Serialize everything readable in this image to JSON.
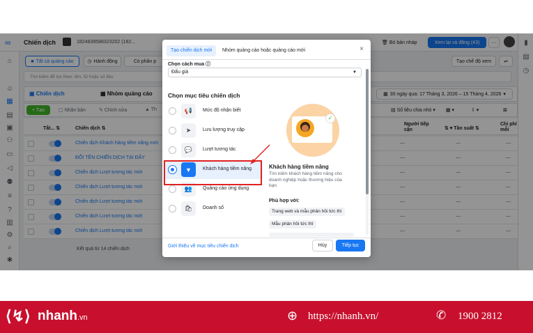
{
  "app": {
    "title": "Chiến dịch",
    "account_id": "1824839588323202 (182...",
    "draft_label": "Bỏ bản nháp",
    "review_button": "Xem lại và đăng (43)",
    "more": "···",
    "tabs": [
      "Tất cả quảng cáo",
      "Hành động",
      "Có phần p"
    ],
    "create_view": "Tạo chế độ xem",
    "search_placeholder": "Tìm kiếm để lọc theo: tên, ID hoặc số liệu",
    "level_tabs": [
      "Chiến dịch",
      "Nhóm quảng cáo"
    ],
    "date_range": "30 ngày qua: 17 Tháng 3, 2026 – 15 Tháng 4, 2026",
    "toolbar": {
      "create": "+ Tạo",
      "duplicate": "Nhân bản",
      "edit": "Chỉnh sửa",
      "third": "Th"
    },
    "right_toolbar": {
      "breakdown": "Số liệu chia nhỏ"
    },
    "columns": [
      "Tắt...",
      "Chiến dịch",
      "Người tiếp cận",
      "Tần suất",
      "Chi phí mỗi"
    ],
    "rows": [
      "Chiến dịch Khách hàng tiềm năng mới",
      "ĐỔI TÊN CHIẾN DỊCH TẠI ĐÂY",
      "Chiến dịch Lượt tương tác mới",
      "Chiến dịch Lượt tương tác mới",
      "Chiến dịch Lượt tương tác mới",
      "Chiến dịch Lượt tương tác mới",
      "Chiến dịch Lượt tương tác mới"
    ],
    "result_text": "Kết quả từ 14 chiến dịch",
    "dash": "—"
  },
  "modal": {
    "tabs": [
      "Tạo chiến dịch mới",
      "Nhóm quảng cáo hoặc quảng cáo mới"
    ],
    "close": "×",
    "buy_label": "Chọn cách mua",
    "buy_value": "Đấu giá",
    "objective_heading": "Chọn mục tiêu chiến dịch",
    "objectives": [
      {
        "label": "Mức độ nhận biết",
        "icon": "megaphone-icon",
        "glyph": "📢"
      },
      {
        "label": "Lưu lượng truy cập",
        "icon": "cursor-icon",
        "glyph": "➤"
      },
      {
        "label": "Lượt tương tác",
        "icon": "chat-icon",
        "glyph": "💬"
      },
      {
        "label": "Khách hàng tiềm năng",
        "icon": "funnel-icon",
        "glyph": "▼"
      },
      {
        "label": "Quảng cáo ứng dụng",
        "icon": "people-icon",
        "glyph": "👥"
      },
      {
        "label": "Doanh số",
        "icon": "bag-icon",
        "glyph": "🛍"
      }
    ],
    "selected_index": 3,
    "detail_title": "Khách hàng tiềm năng",
    "detail_desc": "Tìm kiếm khách hàng tiềm năng cho doanh nghiệp hoặc thương hiệu của bạn.",
    "fit_label": "Phù hợp với:",
    "chips": [
      "Trang web và mẫu phản hồi tức thì",
      "Mẫu phản hồi tức thì"
    ],
    "learn_link": "Giới thiệu về mục tiêu chiến dịch",
    "cancel": "Hủy",
    "continue": "Tiếp tục"
  },
  "banner": {
    "brand": "nhanh",
    "brand_suffix": ".vn",
    "url": "https://nhanh.vn/",
    "phone": "1900 2812"
  },
  "colors": {
    "accent": "#1877f2",
    "banner": "#c8102e",
    "highlight": "#e02020"
  }
}
